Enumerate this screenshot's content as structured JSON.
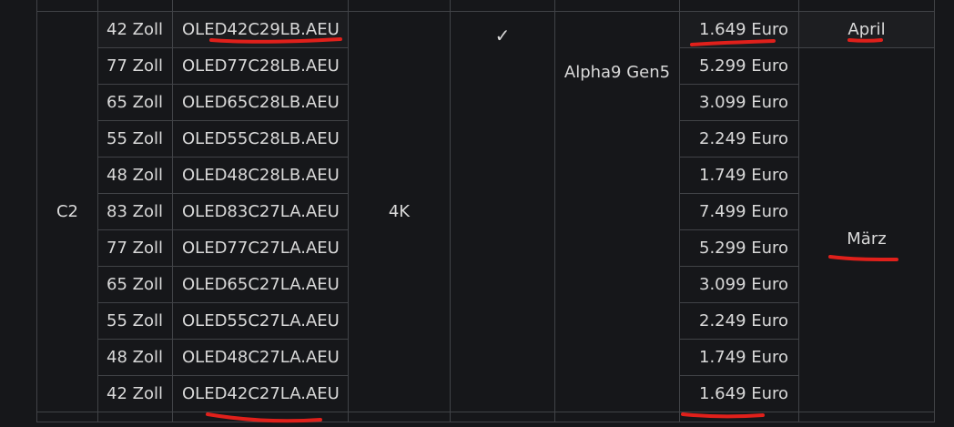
{
  "table": {
    "series": "C2",
    "resolution": "4K",
    "check_mark": "✓",
    "processor": "Alpha9 Gen5",
    "month_april": "April",
    "month_maerz": "März",
    "rows": [
      {
        "size": "42 Zoll",
        "model": "OLED42C29LB.AEU",
        "price": "1.649 Euro"
      },
      {
        "size": "77 Zoll",
        "model": "OLED77C28LB.AEU",
        "price": "5.299 Euro"
      },
      {
        "size": "65 Zoll",
        "model": "OLED65C28LB.AEU",
        "price": "3.099 Euro"
      },
      {
        "size": "55 Zoll",
        "model": "OLED55C28LB.AEU",
        "price": "2.249 Euro"
      },
      {
        "size": "48 Zoll",
        "model": "OLED48C28LB.AEU",
        "price": "1.749 Euro"
      },
      {
        "size": "83 Zoll",
        "model": "OLED83C27LA.AEU",
        "price": "7.499 Euro"
      },
      {
        "size": "77 Zoll",
        "model": "OLED77C27LA.AEU",
        "price": "5.299 Euro"
      },
      {
        "size": "65 Zoll",
        "model": "OLED65C27LA.AEU",
        "price": "3.099 Euro"
      },
      {
        "size": "55 Zoll",
        "model": "OLED55C27LA.AEU",
        "price": "2.249 Euro"
      },
      {
        "size": "48 Zoll",
        "model": "OLED48C27LA.AEU",
        "price": "1.749 Euro"
      },
      {
        "size": "42 Zoll",
        "model": "OLED42C27LA.AEU",
        "price": "1.649 Euro"
      }
    ]
  },
  "annotation_color": "#e0201b"
}
